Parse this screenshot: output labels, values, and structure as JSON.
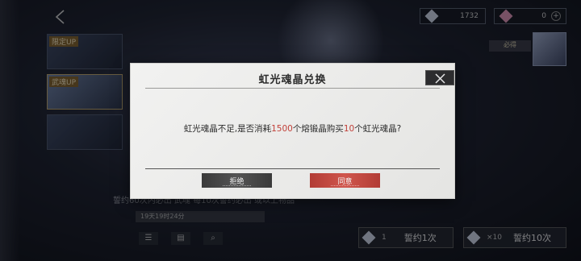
{
  "header": {
    "currency_1": {
      "icon": "crystal-icon",
      "value": "1732"
    },
    "currency_2": {
      "icon": "heart-gem-icon",
      "value": "0"
    }
  },
  "pools": [
    {
      "tag": "限定UP"
    },
    {
      "tag": "武魂UP"
    },
    {
      "tag": ""
    }
  ],
  "right_panel": {
    "pity": "必得"
  },
  "bottom": {
    "info": "誓约60次内必出 武魂 每10次誓约必出 或以上物品",
    "time": "19天19时24分",
    "pull_once": {
      "count": "1",
      "label": "誓约1次"
    },
    "pull_ten": {
      "count": "×10",
      "label": "誓约10次"
    }
  },
  "dialog": {
    "title": "虹光魂晶兑换",
    "message_prefix": "虹光魂晶不足,是否消耗",
    "cost": "1500",
    "message_middle": "个熔锻晶购买",
    "quantity": "10",
    "message_suffix": "个虹光魂晶?",
    "refuse_label": "拒绝",
    "agree_label": "同意"
  },
  "colors": {
    "accent_red": "#c2413a",
    "agree_button": "#d0564c",
    "refuse_button": "#545454"
  }
}
